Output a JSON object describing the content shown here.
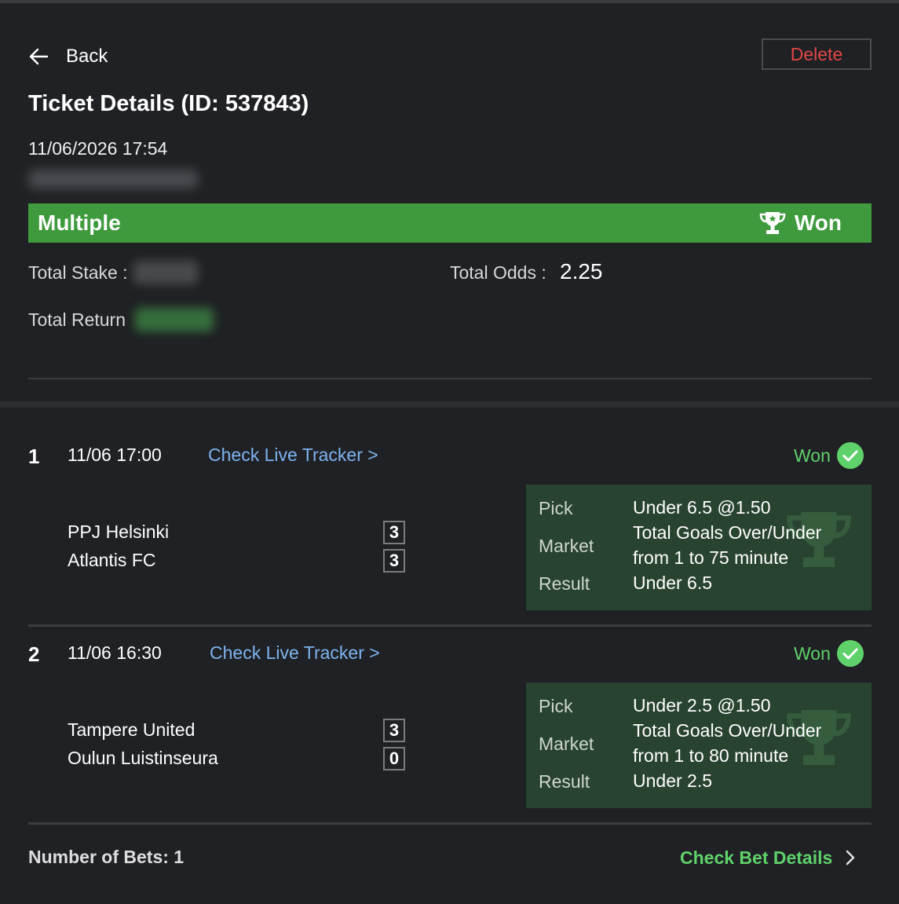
{
  "header": {
    "back_label": "Back",
    "delete_label": "Delete",
    "title": "Ticket Details (ID: 537843)",
    "datetime": "11/06/2026 17:54"
  },
  "status": {
    "type": "Multiple",
    "result": "Won"
  },
  "summary": {
    "total_stake_label": "Total Stake :",
    "total_odds_label": "Total Odds :",
    "total_odds_value": "2.25",
    "total_return_label": "Total Return"
  },
  "legs": [
    {
      "num": "1",
      "time": "11/06 17:00",
      "tracker_label": "Check Live Tracker >",
      "result": "Won",
      "home_team": "PPJ Helsinki",
      "home_score": "3",
      "away_team": "Atlantis FC",
      "away_score": "3",
      "pick_label": "Pick",
      "pick_value": "Under 6.5 @1.50",
      "market_label": "Market",
      "market_value_line1": "Total Goals Over/Under",
      "market_value_line2": "from 1 to 75 minute",
      "result_label": "Result",
      "result_value": "Under 6.5"
    },
    {
      "num": "2",
      "time": "11/06 16:30",
      "tracker_label": "Check Live Tracker >",
      "result": "Won",
      "home_team": "Tampere United",
      "home_score": "3",
      "away_team": "Oulun Luistinseura",
      "away_score": "0",
      "pick_label": "Pick",
      "pick_value": "Under 2.5 @1.50",
      "market_label": "Market",
      "market_value_line1": "Total Goals Over/Under",
      "market_value_line2": "from 1 to 80 minute",
      "result_label": "Result",
      "result_value": "Under 2.5"
    }
  ],
  "footer": {
    "bets_count": "Number of Bets: 1",
    "details_label": "Check Bet Details"
  },
  "colors": {
    "won_green": "#5fd16a",
    "status_bar": "#3e9a3d",
    "delete_red": "#e24646",
    "tracker_blue": "#7db3f0",
    "pick_box": "#28432f"
  },
  "icons": [
    "arrow-left-icon",
    "trophy-icon",
    "check-circle-icon",
    "chevron-right-icon"
  ]
}
